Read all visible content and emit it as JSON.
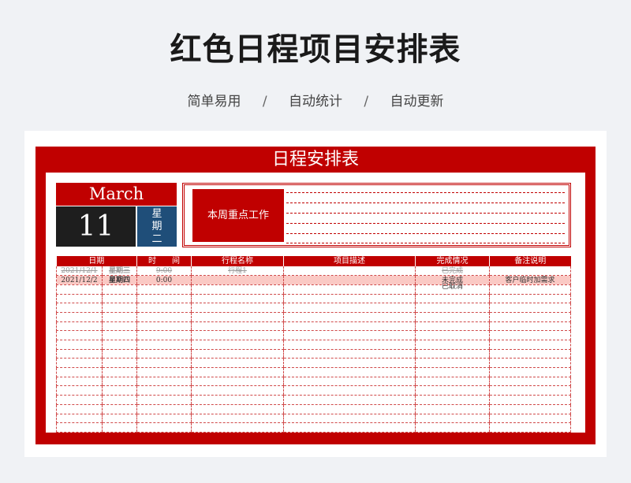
{
  "header": {
    "title": "红色日程项目安排表",
    "tags": [
      "简单易用",
      "自动统计",
      "自动更新"
    ],
    "separator": "/"
  },
  "sheet": {
    "title": "日程安排表",
    "month": "March",
    "day": "11",
    "weekday_chars": [
      "星",
      "期",
      "二"
    ],
    "focus_label": "本周重点工作",
    "columns": [
      "日期",
      "时　　间",
      "行程名称",
      "项目描述",
      "完成情况",
      "备注说明"
    ],
    "rows": [
      {
        "date": "2021/12/1",
        "weekday": "星期三",
        "time": "9:00",
        "name": "行程1",
        "desc": "",
        "status": "已完成",
        "note": ""
      },
      {
        "date": "2021/12/2",
        "weekday": "星期四",
        "time": "0:00",
        "name": "",
        "desc": "",
        "status": "未完成",
        "note": "客户临时加需求"
      }
    ],
    "status_extra": "已取消",
    "colors": {
      "accent": "#c00000",
      "navy": "#1f4e79",
      "highlight": "#fac9c4"
    }
  }
}
